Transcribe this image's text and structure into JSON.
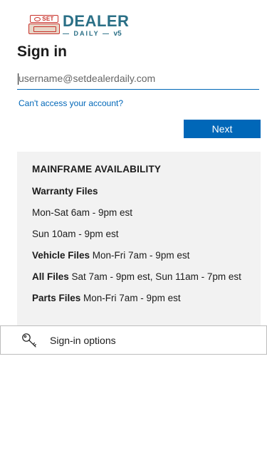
{
  "logo": {
    "badge_text": "SET",
    "brand_top": "DEALER",
    "brand_bottom": "DAILY",
    "version": "v5"
  },
  "page_title": "Sign in",
  "username": {
    "value": "",
    "placeholder": "username@setdealerdaily.com"
  },
  "cant_access_link": "Can't access your account?",
  "next_button": "Next",
  "availability": {
    "title": "MAINFRAME AVAILABILITY",
    "warranty_label": "Warranty Files",
    "warranty_weekday": "Mon-Sat 6am - 9pm est",
    "warranty_sunday": "Sun 10am - 9pm est",
    "vehicle_label": "Vehicle Files",
    "vehicle_hours": " Mon-Fri 7am - 9pm est",
    "all_label": "All Files",
    "all_hours": " Sat 7am - 9pm est, Sun 11am - 7pm est",
    "parts_label": "Parts Files",
    "parts_hours": " Mon-Fri 7am - 9pm est"
  },
  "signin_options": {
    "label": "Sign-in options",
    "icon": "key-icon"
  },
  "colors": {
    "accent": "#0067b8",
    "brand_teal": "#2a6f86",
    "brand_red": "#c8312a",
    "panel_bg": "#f2f2f2"
  }
}
